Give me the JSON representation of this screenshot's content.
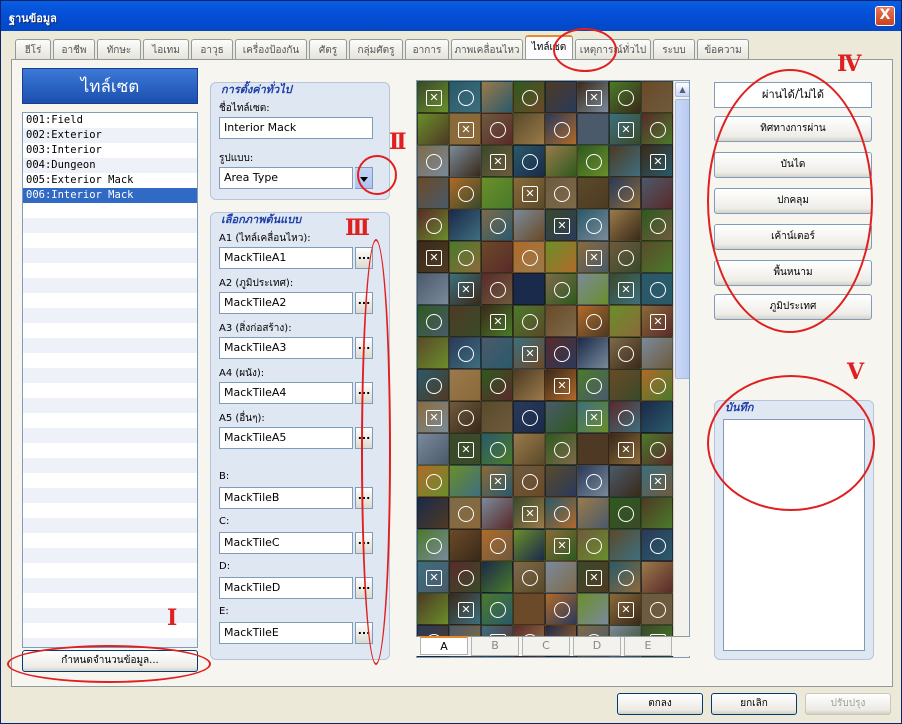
{
  "window": {
    "title": "ฐานข้อมูล",
    "close_label": "X"
  },
  "tabs": [
    {
      "label": "ฮีโร่",
      "w": 36
    },
    {
      "label": "อาชีพ",
      "w": 42
    },
    {
      "label": "ทักษะ",
      "w": 44
    },
    {
      "label": "ไอเทม",
      "w": 46
    },
    {
      "label": "อาวุธ",
      "w": 42
    },
    {
      "label": "เครื่องป้องกัน",
      "w": 72
    },
    {
      "label": "ศัตรู",
      "w": 38
    },
    {
      "label": "กลุ่มศัตรู",
      "w": 54
    },
    {
      "label": "อาการ",
      "w": 44
    },
    {
      "label": "ภาพเคลื่อนไหว",
      "w": 72
    },
    {
      "label": "ไทล์เซต",
      "w": 48,
      "active": true
    },
    {
      "label": "เหตุการณ์ทั่วไป",
      "w": 76
    },
    {
      "label": "ระบบ",
      "w": 42
    },
    {
      "label": "ข้อความ",
      "w": 52
    }
  ],
  "left": {
    "header": "ไทล์เซต",
    "items": [
      "001:Field",
      "002:Exterior",
      "003:Interior",
      "004:Dungeon",
      "005:Exterior Mack",
      "006:Interior Mack"
    ],
    "selected_index": 5,
    "change_max_button": "กำหนดจำนวนข้อมูล..."
  },
  "general": {
    "title": "การตั้งค่าทั่วไป",
    "name_label": "ชื่อไทล์เซต:",
    "name_value": "Interior Mack",
    "mode_label": "รูปแบบ:",
    "mode_value": "Area Type"
  },
  "graphics": {
    "title": "เลือกภาพต้นแบบ",
    "slots": [
      {
        "label": "A1 (ไทล์เคลื่อนไหว):",
        "value": "MackTileA1"
      },
      {
        "label": "A2 (ภูมิประเทศ):",
        "value": "MackTileA2"
      },
      {
        "label": "A3 (สิ่งก่อสร้าง):",
        "value": "MackTileA3"
      },
      {
        "label": "A4 (ผนัง):",
        "value": "MackTileA4"
      },
      {
        "label": "A5 (อื่นๆ):",
        "value": "MackTileA5"
      },
      {
        "label": "B:",
        "value": "MackTileB"
      },
      {
        "label": "C:",
        "value": "MackTileC"
      },
      {
        "label": "D:",
        "value": "MackTileD"
      },
      {
        "label": "E:",
        "value": "MackTileE"
      }
    ],
    "browse_label": "..."
  },
  "tile_tabs": [
    "A",
    "B",
    "C",
    "D",
    "E"
  ],
  "tile_tab_active": 0,
  "tile_palette": [
    "#3a4a2a",
    "#2e5a1f",
    "#4a7a2a",
    "#6a8e2a",
    "#5a4a2a",
    "#3e6e7e",
    "#7e6a4a",
    "#2a5a6a",
    "#4e3a24",
    "#6a4a28",
    "#8a6a3a",
    "#2a3a5a",
    "#5a2a2a",
    "#7a8a9a",
    "#9a7a4a",
    "#3a2a1a",
    "#b06a2a",
    "#6e5a3e",
    "#4a5a6a",
    "#1a2a4a"
  ],
  "right_buttons": [
    "ผ่านได้/ไม่ได้",
    "ทิศทางการผ่าน",
    "บันได",
    "ปกคลุม",
    "เค้าน์เตอร์",
    "พื้นหนาม",
    "ภูมิประเทศ"
  ],
  "notes": {
    "title": "บันทึก"
  },
  "annotations": [
    "I",
    "II",
    "III",
    "IV",
    "V"
  ],
  "bottom": {
    "ok": "ตกลง",
    "cancel": "ยกเลิก",
    "apply": "ปรับปรุง"
  }
}
